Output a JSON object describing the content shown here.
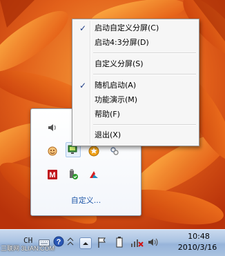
{
  "context_menu": {
    "items": [
      {
        "label": "启动自定义分屏(C)",
        "checked": true
      },
      {
        "label": "启动4:3分屏(D)",
        "checked": false
      },
      {
        "label": "自定义分屏(S)",
        "checked": false
      },
      {
        "label": "随机启动(A)",
        "checked": true
      },
      {
        "label": "功能演示(M)",
        "checked": false
      },
      {
        "label": "帮助(F)",
        "checked": false
      },
      {
        "label": "退出(X)",
        "checked": false
      }
    ],
    "check_glyph": "✓"
  },
  "tray_flyout": {
    "icons": [
      "speaker-icon",
      "display-app-icon",
      "antivirus-icon",
      "wireless-network-icon",
      "assistant-icon",
      "gold-star-icon",
      "network-adapter-icon",
      "mcafee-icon",
      "usb-safe-icon",
      "red-arrow-app-icon"
    ],
    "customize_label": "自定义..."
  },
  "taskbar": {
    "language": "CH",
    "clock_time": "10:48",
    "clock_date": "2010/3/16",
    "watermark": "三联网 3LIAN.COM"
  },
  "colors": {
    "menu_check": "#1d3c86",
    "link": "#1e57a8",
    "taskbar": "#aac3e2"
  }
}
